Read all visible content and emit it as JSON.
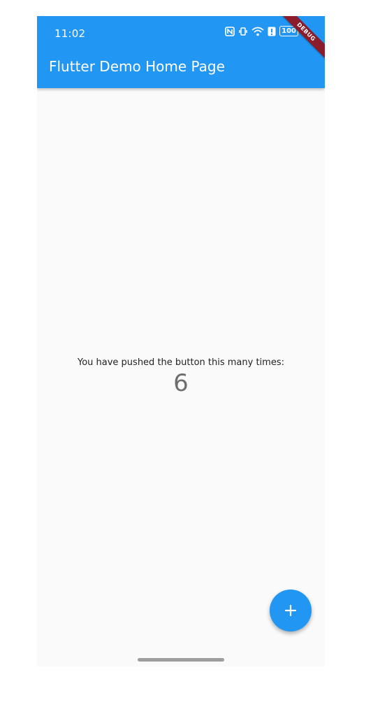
{
  "status_bar": {
    "time": "11:02",
    "battery": "100"
  },
  "app_bar": {
    "title": "Flutter Demo Home Page"
  },
  "debug_banner": {
    "label": "DEBUG"
  },
  "content": {
    "label": "You have pushed the button this many times:",
    "counter": "6"
  },
  "fab": {
    "icon": "plus-icon"
  },
  "colors": {
    "primary": "#2196f3",
    "background": "#fafafa",
    "debug_banner": "#8a1c2b"
  }
}
